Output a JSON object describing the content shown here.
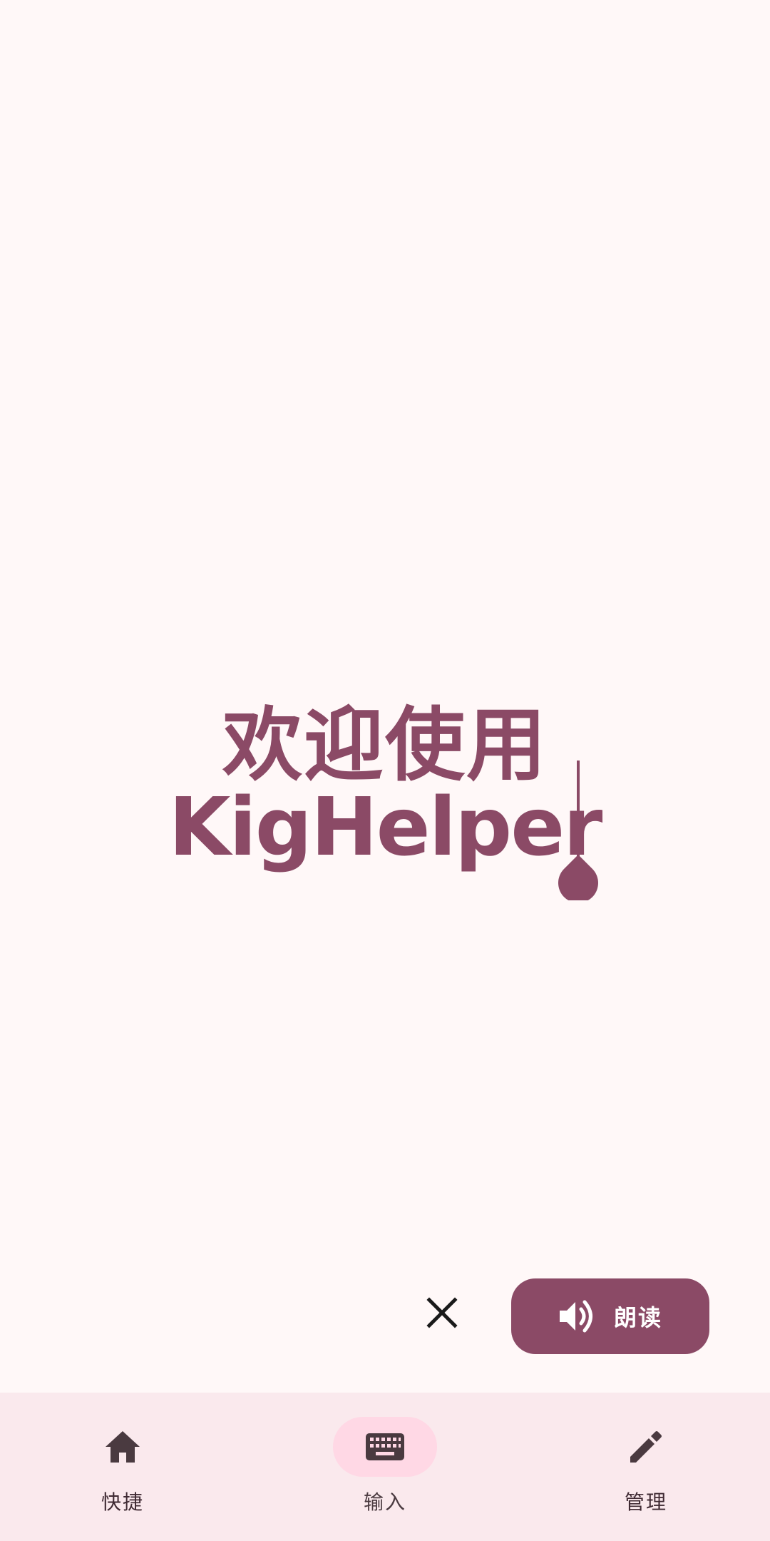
{
  "editor": {
    "line1": "欢迎使用",
    "line2": "KigHelper"
  },
  "actions": {
    "close_icon": "close-icon",
    "read_icon": "volume-icon",
    "read_label": "朗读"
  },
  "bottom_nav": {
    "items": [
      {
        "label": "快捷",
        "icon": "home-icon",
        "active": false
      },
      {
        "label": "输入",
        "icon": "keyboard-icon",
        "active": true
      },
      {
        "label": "管理",
        "icon": "pencil-icon",
        "active": false
      }
    ]
  },
  "colors": {
    "background": "#FFF8F8",
    "accent": "#8B4A66",
    "nav_background": "#FAE9ED",
    "nav_active_pill": "#FFD8E5",
    "icon": "#3F2A33"
  }
}
